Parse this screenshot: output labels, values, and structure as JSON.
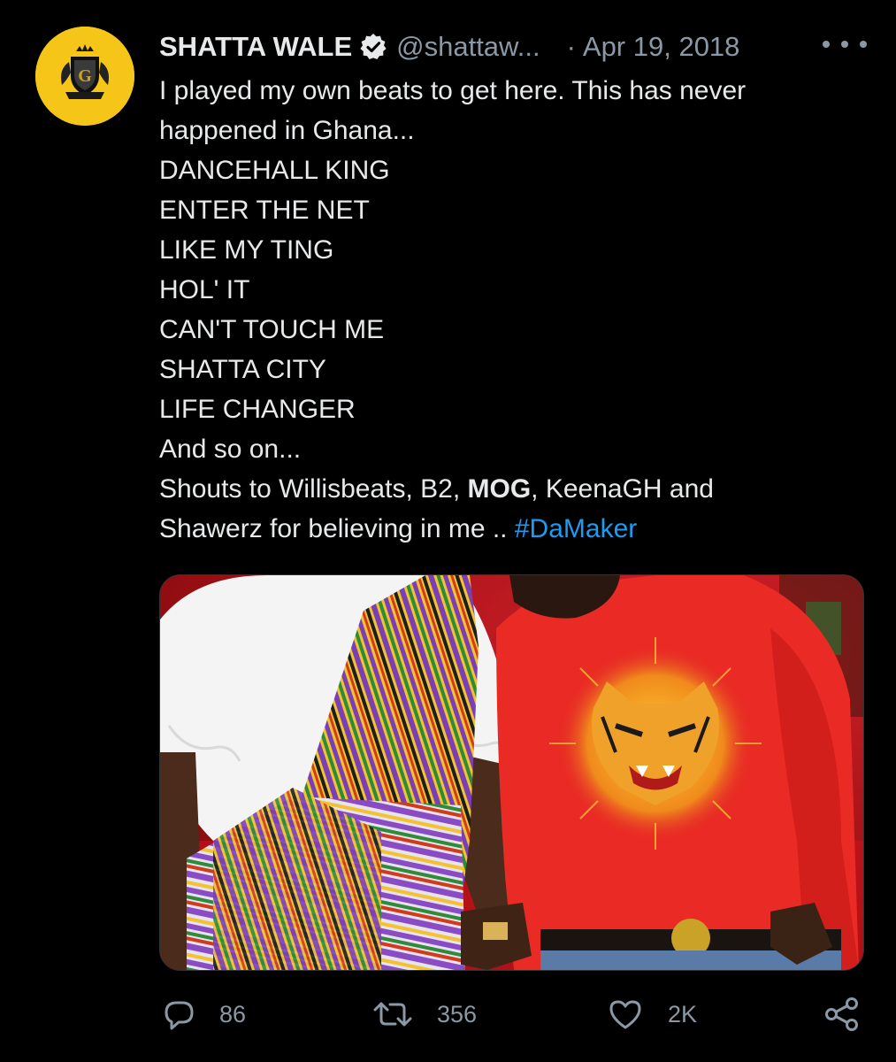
{
  "tweet": {
    "author_name": "SHATTA WALE",
    "handle": "@shattaw...",
    "separator": "·",
    "date": "Apr 19, 2018",
    "lines": [
      "I played my own beats to get here. This has never",
      "happened in Ghana...",
      "DANCEHALL KING",
      "ENTER THE NET",
      "LIKE MY TING",
      "HOL' IT",
      "CAN'T TOUCH ME",
      "SHATTA CITY",
      "LIFE CHANGER",
      "And so on..."
    ],
    "shouts_prefix": "Shouts to Willisbeats, B2, ",
    "shouts_mention": "MOG",
    "shouts_suffix": ", KeenaGH and",
    "last_line_prefix": "Shawerz for believing in me .. ",
    "hashtag": "#DaMaker"
  },
  "actions": {
    "replies": "86",
    "retweets": "356",
    "likes": "2K"
  },
  "icons": {
    "verified": "verified-badge-icon",
    "more": "more-options-icon",
    "reply": "reply-icon",
    "retweet": "retweet-icon",
    "like": "heart-icon",
    "share": "share-icon"
  },
  "colors": {
    "background": "#000000",
    "text": "#e7e9ea",
    "secondary": "#8b98a5",
    "hashtag": "#1d9bf0",
    "avatar": "#f5c518"
  }
}
